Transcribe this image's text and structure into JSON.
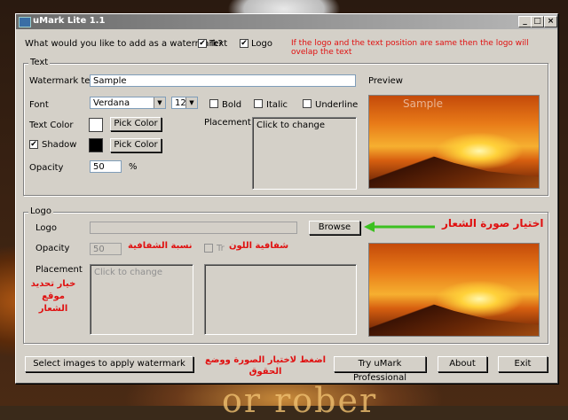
{
  "window": {
    "title": "uMark Lite 1.1",
    "controls": {
      "minimize": "_",
      "maximize": "□",
      "close": "×"
    }
  },
  "header": {
    "question": "What would you like to add as a watermark?",
    "text_checkbox_label": "Text",
    "text_checked": true,
    "logo_checkbox_label": "Logo",
    "logo_checked": true,
    "overlap_warning": "If the logo and the text position are same then the logo will ovelap the text"
  },
  "text_group": {
    "title": "Text",
    "watermark_text_label": "Watermark text",
    "watermark_text_value": "Sample",
    "preview_label": "Preview",
    "font_label": "Font",
    "font_value": "Verdana",
    "size_value": "12",
    "bold_label": "Bold",
    "italic_label": "Italic",
    "underline_label": "Underline",
    "text_color_label": "Text Color",
    "text_color_value": "#ffffff",
    "pick_color_label": "Pick Color",
    "shadow_label": "Shadow",
    "shadow_checked": true,
    "shadow_color_value": "#000000",
    "placement_label": "Placement",
    "click_to_change": "Click to change",
    "opacity_label": "Opacity",
    "opacity_value": "50",
    "opacity_unit": "%",
    "preview_overlay_text": "Sample"
  },
  "logo_group": {
    "title": "Logo",
    "logo_label": "Logo",
    "logo_path_value": "",
    "browse_label": "Browse",
    "browse_annotation_ar": "اختيار صورة الشعار",
    "opacity_label": "Opacity",
    "opacity_value": "50",
    "opacity_annotation_ar": "نسبة الشفافية",
    "transparent_label": "Tr",
    "transparency_annotation_ar": "شفافية اللون",
    "placement_label": "Placement",
    "placement_annotation_ar": "خيار تحديد موقع الشعار",
    "click_to_change": "Click to change"
  },
  "footer": {
    "select_images_label": "Select images to apply watermark",
    "select_annotation_ar": "اضغط لاختيار الصورة ووضع الحقوق",
    "pro_label": "Try uMark Professional",
    "about_label": "About",
    "exit_label": "Exit"
  },
  "desktop": {
    "bottom_text": "or rober"
  }
}
